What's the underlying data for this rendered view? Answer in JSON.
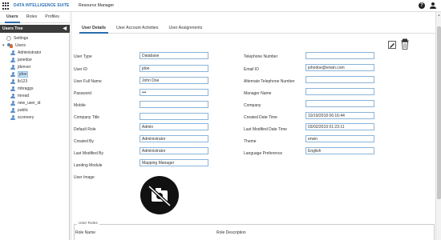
{
  "app": {
    "suite_name": "DATA INTELLIGENCE SUITE",
    "title": "Resource Manager",
    "help_symbol": "?"
  },
  "left_tabs": [
    "Users",
    "Roles",
    "Profiles"
  ],
  "tree": {
    "header": "Users Tree",
    "collapse_symbol": "◀",
    "settings_label": "Settings",
    "users_root": "Users",
    "users": [
      "Administrator",
      "janedoe",
      "jdenver",
      "jdoe",
      "lb123",
      "mbraggs",
      "mread",
      "new_user_id",
      "public",
      "sconnery"
    ],
    "selected": "jdoe"
  },
  "main_tabs": [
    "User Details",
    "User Account Activities",
    "User Assignments"
  ],
  "form": {
    "left": [
      {
        "label": "User Type",
        "value": "Database"
      },
      {
        "label": "User ID",
        "value": "jdoe"
      },
      {
        "label": "User Full Name",
        "value": "John Doe"
      },
      {
        "label": "Password",
        "value": "•••"
      },
      {
        "label": "Mobile",
        "value": ""
      },
      {
        "label": "Company Title",
        "value": ""
      },
      {
        "label": "Default Role",
        "value": "Admin"
      },
      {
        "label": "Created By",
        "value": "Administrator"
      },
      {
        "label": "Last Modified By",
        "value": "Administrator"
      },
      {
        "label": "Landing Module",
        "value": "Mapping Manager"
      }
    ],
    "right": [
      {
        "label": "Telephone Number",
        "value": ""
      },
      {
        "label": "Email ID",
        "value": "johndoe@erwin.com"
      },
      {
        "label": "Alternate Telephone Number",
        "value": ""
      },
      {
        "label": "Manager Name",
        "value": ""
      },
      {
        "label": "Company",
        "value": ""
      },
      {
        "label": "Created Date Time",
        "value": "10/19/2018 06:16:44"
      },
      {
        "label": "Last Modified Date Time",
        "value": "03/02/2019 01:23:11"
      },
      {
        "label": "Theme",
        "value": "erwin"
      },
      {
        "label": "Language Preference",
        "value": "English"
      }
    ],
    "user_image_label": "User Image"
  },
  "user_roles": {
    "legend": "User Roles",
    "columns": [
      "Role Name",
      "Role Description"
    ]
  },
  "colors": {
    "accent": "#2a6db0",
    "input_border": "#8ab4d8",
    "tree_header": "#3b3b3b"
  }
}
